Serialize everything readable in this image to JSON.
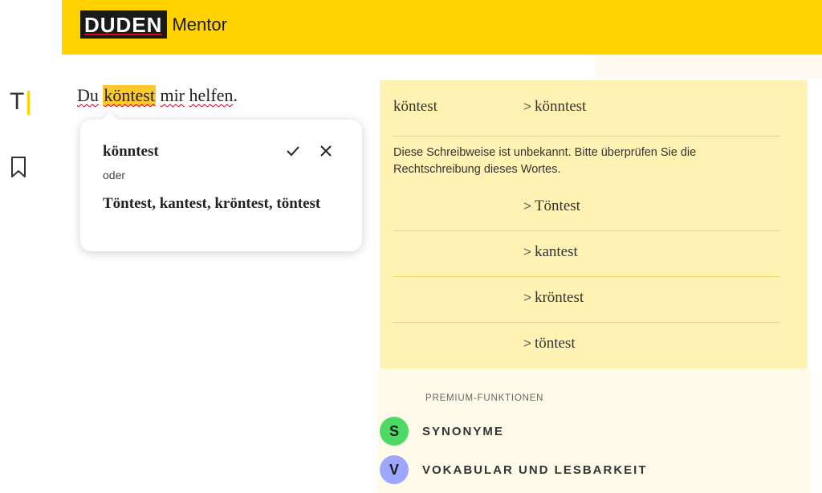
{
  "header": {
    "logo_brand": "DUDEN",
    "logo_product": "Mentor",
    "color": "#ffd200"
  },
  "rail": {
    "text_tool_glyph": "T",
    "icons": [
      "text-cursor-icon",
      "bookmark-icon"
    ]
  },
  "editor": {
    "words": [
      "Du",
      "köntest",
      "mir",
      "helfen",
      "."
    ]
  },
  "popup": {
    "suggestion": "könntest",
    "or_label": "oder",
    "alternatives": "Töntest, kantest, kröntest, töntest",
    "accept_icon": "check-icon",
    "dismiss_icon": "close-icon"
  },
  "panel": {
    "original": "köntest",
    "main_suggestion": "könntest",
    "message": "Diese Schreibweise ist unbekannt. Bitte überprüfen Sie die Rechtschreibung dieses Wortes.",
    "alternatives": [
      "Töntest",
      "kantest",
      "kröntest",
      "töntest"
    ],
    "chevron": ">"
  },
  "premium": {
    "title": "PREMIUM-FUNKTIONEN",
    "features": [
      {
        "letter": "S",
        "label": "SYNONYME",
        "color": "#4cd964"
      },
      {
        "letter": "V",
        "label": "VOKABULAR UND LESBARKEIT",
        "color": "#9ea7ff"
      }
    ]
  }
}
